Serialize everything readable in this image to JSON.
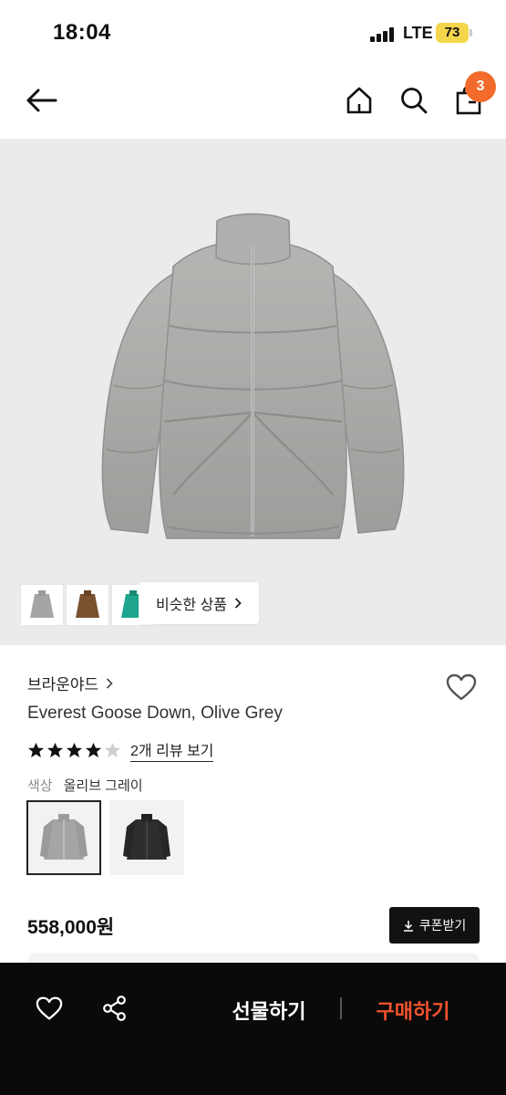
{
  "status_bar": {
    "time": "18:04",
    "network": "LTE",
    "battery": "73"
  },
  "header": {
    "cart_count": "3"
  },
  "gallery": {
    "similar_label": "비슷한 상품",
    "thumbnails": [
      {
        "color": "#a4a6a3",
        "icon": "grey-jacket-thumbnail"
      },
      {
        "color": "#7a5230",
        "icon": "brown-jacket-thumbnail"
      },
      {
        "color": "#1ea58e",
        "icon": "teal-jacket-thumbnail"
      }
    ]
  },
  "product": {
    "brand": "브라운야드",
    "name": "Everest Goose Down, Olive Grey",
    "rating": 4,
    "rating_max": 5,
    "review_link": "2개 리뷰 보기",
    "color_label": "색상",
    "color_value": "올리브 그레이",
    "swatches": [
      {
        "color": "#a4a6a3",
        "icon": "grey-jacket-swatch",
        "selected": true
      },
      {
        "color": "#2e2e2e",
        "icon": "black-jacket-swatch",
        "selected": false
      }
    ],
    "price": "558,000원",
    "coupon_label": "쿠폰받기"
  },
  "bottom_bar": {
    "gift_label": "선물하기",
    "buy_label": "구매하기"
  },
  "colors": {
    "accent": "#f26b2a",
    "buy": "#f2522e",
    "bottom_bar_bg": "#0a0a0a",
    "hero_bg": "#ebebeb"
  }
}
